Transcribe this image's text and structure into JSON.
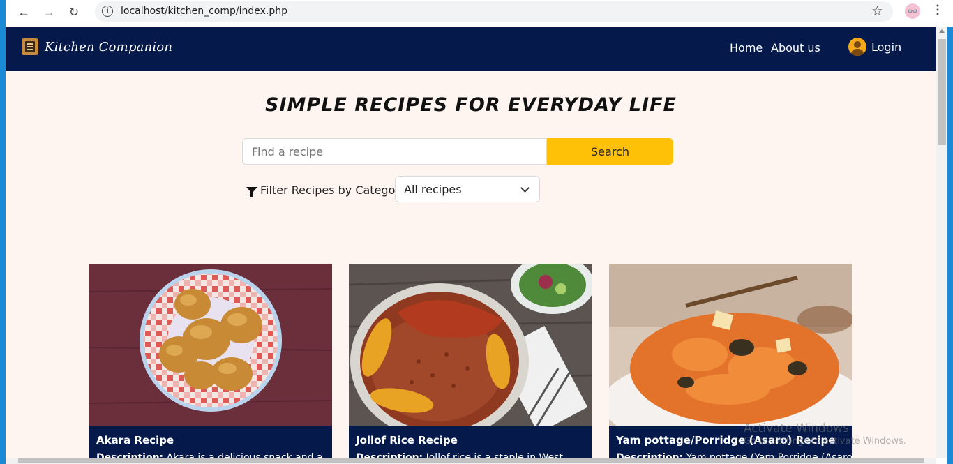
{
  "browser": {
    "url": "localhost/kitchen_comp/index.php",
    "back_icon": "←",
    "forward_icon": "→",
    "reload_icon": "↻",
    "star_icon": "☆",
    "menu_icon": "⋮"
  },
  "navbar": {
    "brand": "Kitchen Companion",
    "links": [
      "Home",
      "About us"
    ],
    "login": "Login"
  },
  "hero": {
    "title": "SIMPLE RECIPES FOR EVERYDAY LIFE"
  },
  "search": {
    "placeholder": "Find a recipe",
    "button": "Search"
  },
  "filter": {
    "label": "Filter Recipes by Category",
    "selected": "All recipes"
  },
  "cards": [
    {
      "title": "Akara Recipe",
      "desc_label": "Description:",
      "desc": "Akara is a delicious snack and a"
    },
    {
      "title": "Jollof Rice Recipe",
      "desc_label": "Description:",
      "desc": "Jollof rice is a staple in West"
    },
    {
      "title": "Yam pottage/Porridge (Asaro) Recipe",
      "desc_label": "Description:",
      "desc": "Yam pottage (Yam Porridge (Asaro)"
    }
  ],
  "watermark": {
    "line1": "Activate Windows",
    "line2": "Go to Settings to activate Windows."
  },
  "colors": {
    "navbar": "#051a4a",
    "page_bg": "#fff5f0",
    "accent": "#ffc107"
  }
}
